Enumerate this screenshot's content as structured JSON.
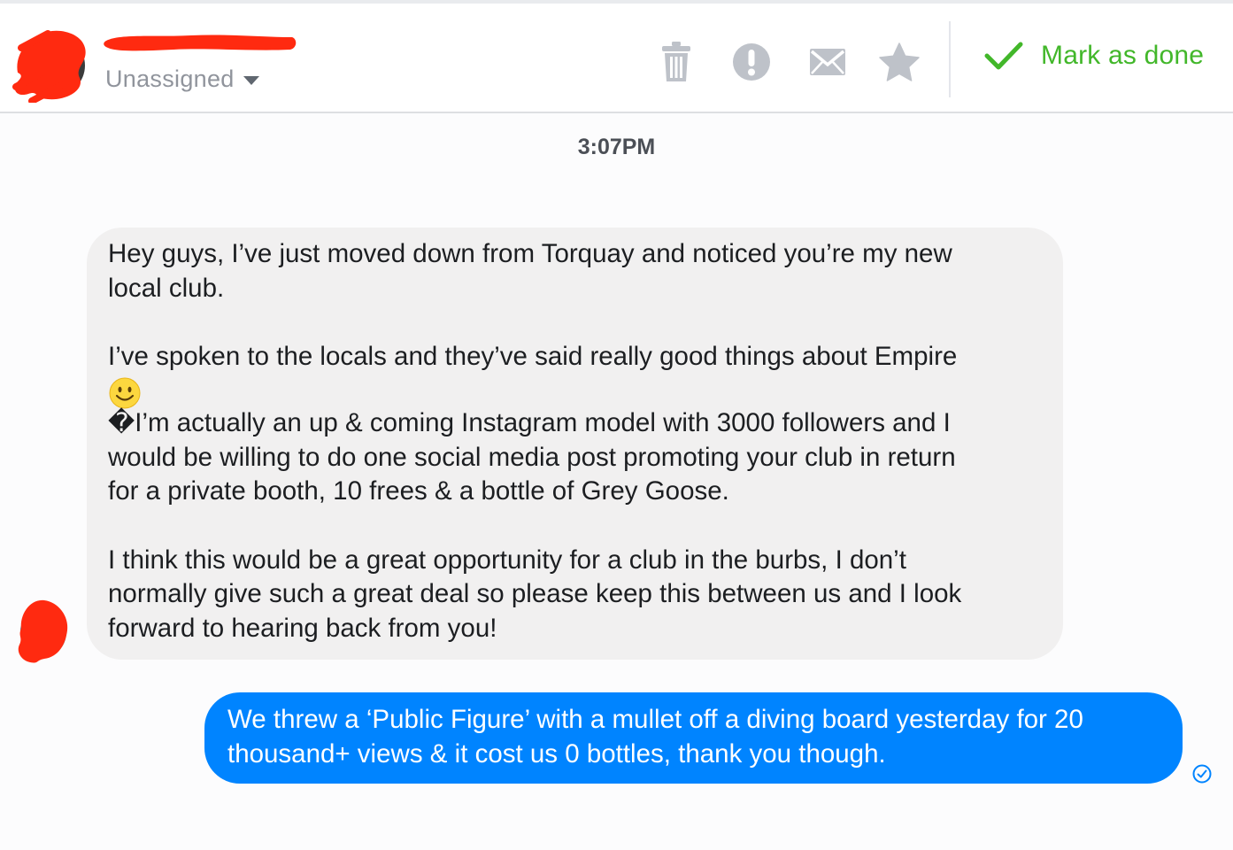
{
  "header": {
    "assignee_label": "Unassigned",
    "icons": [
      "trash-icon",
      "alert-icon",
      "envelope-icon",
      "star-icon"
    ],
    "done_label": "Mark as done"
  },
  "thread": {
    "timestamp": "3:07PM",
    "incoming": {
      "lines": [
        "Hey guys, I’ve just moved down from Torquay and noticed you’re my new",
        "local club.",
        "I’ve spoken to the locals and they’ve said really good things about Empire",
        "�I’m actually an up & coming Instagram model with 3000 followers and I",
        "would be willing to do one social media post promoting your club in return",
        "for a private booth, 10 frees & a bottle of Grey Goose.",
        "I think this would be a great opportunity for a club in the burbs, I don’t",
        "normally give such a great deal so please keep this between us and I look",
        "forward to hearing back from you!"
      ]
    },
    "outgoing": {
      "lines": [
        "We threw a ‘Public Figure’ with a mullet off a diving board yesterday for 20",
        "thousand+ views & it cost us 0 bottles, thank you though."
      ]
    }
  },
  "colors": {
    "outgoing_bubble": "#0084ff",
    "incoming_bubble": "#f1f0f0",
    "done_green": "#42b72a",
    "icon_gray": "#bec2c9",
    "redaction_red": "#ff2a10"
  }
}
